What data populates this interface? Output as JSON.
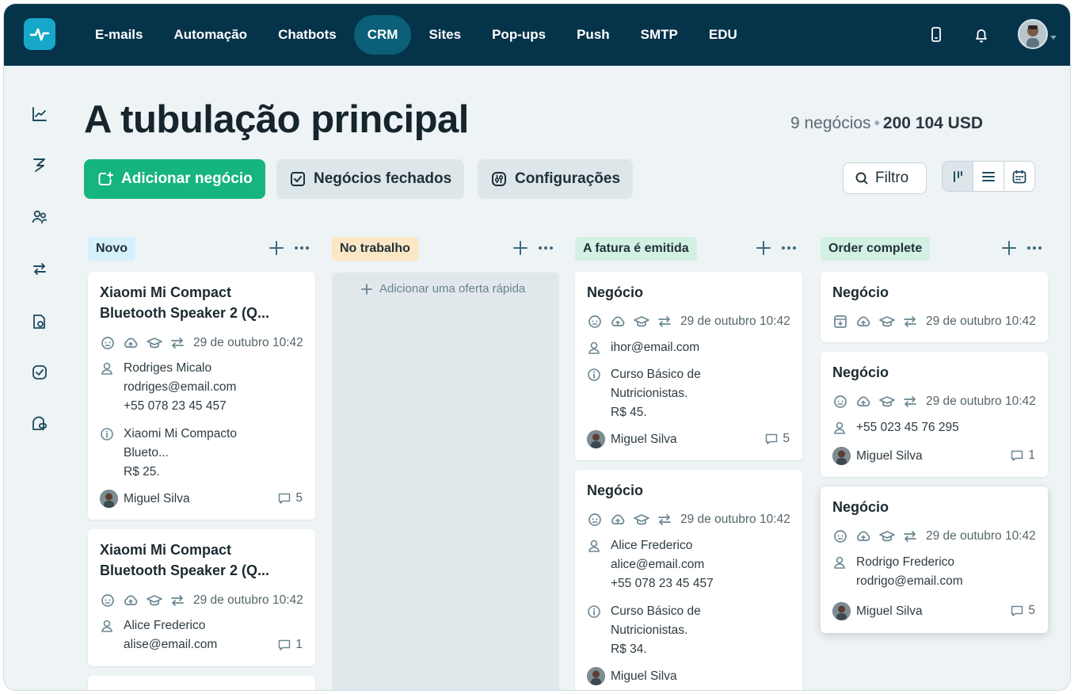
{
  "topbar": {
    "nav": [
      "E-mails",
      "Automação",
      "Chatbots",
      "CRM",
      "Sites",
      "Pop-ups",
      "Push",
      "SMTP",
      "EDU"
    ],
    "active_nav": "CRM"
  },
  "page": {
    "title": "A tubulação principal",
    "deals_count": "9 negócios",
    "total": "200 104 USD"
  },
  "toolbar": {
    "add_label": "Adicionar negócio",
    "closed_label": "Negócios fechados",
    "settings_label": "Configurações",
    "filter_label": "Filtro"
  },
  "columns": [
    {
      "title": "Novo",
      "color": "#d6f0fb"
    },
    {
      "title": "No trabalho",
      "color": "#fbe7c6",
      "quick_add": "Adicionar uma oferta rápida"
    },
    {
      "title": "A fatura é emitida",
      "color": "#d3f1e2"
    },
    {
      "title": "Order complete",
      "color": "#d3f1e2"
    }
  ],
  "cards": {
    "c1": {
      "title1": "Xiaomi Mi Compact",
      "title2": "Bluetooth Speaker 2 (Q...",
      "date": "29 de outubro 10:42",
      "contact_name": "Rodriges Micalo",
      "contact_email": "rodriges@email.com",
      "contact_phone": "+55 078 23 45 457",
      "product1": "Xiaomi Mi Compacto",
      "product2": "Blueto...",
      "price": "R$ 25.",
      "owner": "Miguel Silva",
      "comments": "5"
    },
    "c2": {
      "title1": "Xiaomi Mi Compact",
      "title2": "Bluetooth Speaker 2 (Q...",
      "date": "29 de outubro 10:42",
      "contact_name": "Alice Frederico",
      "contact_email": "alise@email.com",
      "comments": "1"
    },
    "c3": {
      "title": "Negócio",
      "date": "29 de outubro 10:42",
      "contact_email": "ihor@email.com",
      "product1": "Curso Básico de",
      "product2": "Nutricionistas.",
      "price": "R$ 45.",
      "owner": "Miguel Silva",
      "comments": "5"
    },
    "c4": {
      "title": "Negócio",
      "date": "29 de outubro 10:42",
      "contact_name": "Alice Frederico",
      "contact_email": "alice@email.com",
      "contact_phone": "+55 078 23 45 457",
      "product1": "Curso Básico de",
      "product2": "Nutricionistas.",
      "price": "R$ 34.",
      "owner": "Miguel Silva"
    },
    "c5": {
      "title": "Negócio",
      "date": "29 de outubro 10:42"
    },
    "c6": {
      "title": "Negócio",
      "date": "29 de outubro 10:42",
      "contact_phone": "+55 023 45 76 295",
      "owner": "Miguel Silva",
      "comments": "1"
    },
    "c7": {
      "title": "Negócio",
      "date": "29 de outubro 10:42",
      "contact_name": "Rodrigo Frederico",
      "contact_email": "rodrigo@email.com",
      "owner": "Miguel Silva",
      "comments": "5"
    }
  },
  "colors": {
    "topbar": "#05334a",
    "accent": "#16b47e",
    "brand": "#17a8c9"
  }
}
